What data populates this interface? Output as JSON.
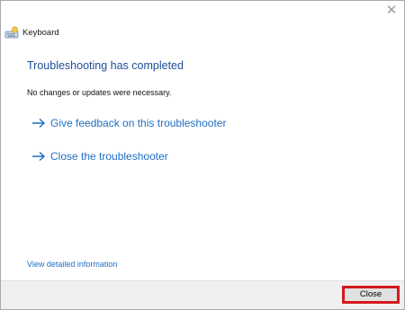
{
  "window": {
    "title": "Keyboard",
    "close_glyph": "✕",
    "app_icon": "keyboard-troubleshooter-icon"
  },
  "main": {
    "heading": "Troubleshooting has completed",
    "subtext": "No changes or updates were necessary.",
    "links": [
      {
        "label": "Give feedback on this troubleshooter",
        "icon": "arrow-right-icon"
      },
      {
        "label": "Close the troubleshooter",
        "icon": "arrow-right-icon"
      }
    ],
    "details_link": "View detailed information"
  },
  "footer": {
    "close_label": "Close",
    "highlight_color": "#d4191f"
  },
  "colors": {
    "heading": "#1f4e99",
    "link": "#1f6fc5"
  }
}
